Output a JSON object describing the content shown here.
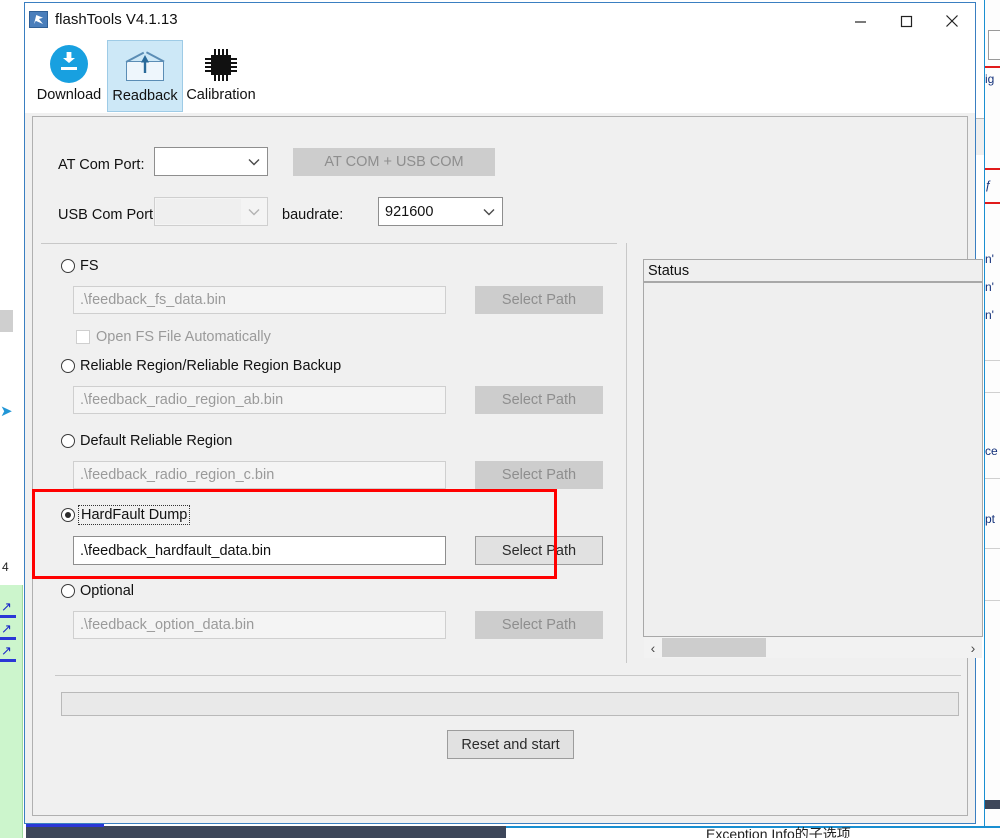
{
  "window": {
    "title": "flashTools V4.1.13",
    "app_icon": "app-icon",
    "minimize_label": "Minimize",
    "maximize_label": "Maximize",
    "close_label": "Close"
  },
  "toolbar": {
    "items": [
      {
        "label": "Download",
        "icon": "download-icon",
        "selected": false
      },
      {
        "label": "Readback",
        "icon": "envelope-upload-icon",
        "selected": true
      },
      {
        "label": "Calibration",
        "icon": "chip-icon",
        "selected": false
      }
    ]
  },
  "ports": {
    "at_com_label": "AT Com Port:",
    "at_com_value": "",
    "at_com_placeholder": "",
    "at_usb_button": "AT COM + USB COM",
    "usb_com_label": "USB Com Port:",
    "usb_com_value": "",
    "baudrate_label": "baudrate:",
    "baudrate_value": "921600"
  },
  "options": [
    {
      "id": "fs",
      "label": "FS",
      "selected": false,
      "path": ".\\feedback_fs_data.bin",
      "button": "Select Path",
      "enabled": false,
      "checkbox": {
        "label": "Open FS File Automatically",
        "checked": false
      }
    },
    {
      "id": "reliable-region-backup",
      "label": "Reliable Region/Reliable Region Backup",
      "selected": false,
      "path": ".\\feedback_radio_region_ab.bin",
      "button": "Select Path",
      "enabled": false
    },
    {
      "id": "default-reliable-region",
      "label": "Default Reliable Region",
      "selected": false,
      "path": ".\\feedback_radio_region_c.bin",
      "button": "Select Path",
      "enabled": false
    },
    {
      "id": "hardfault-dump",
      "label": "HardFault Dump",
      "selected": true,
      "path": ".\\feedback_hardfault_data.bin",
      "button": "Select Path",
      "enabled": true,
      "highlighted": true
    },
    {
      "id": "optional",
      "label": "Optional",
      "selected": false,
      "path": ".\\feedback_option_data.bin",
      "button": "Select Path",
      "enabled": false
    }
  ],
  "status": {
    "header": "Status",
    "content": "",
    "scroll_left": "‹",
    "scroll_right": "›"
  },
  "footer": {
    "progress_value": "",
    "action_button": "Reset and start"
  },
  "colors": {
    "accent_blue": "#18a0e0",
    "selected_tab": "#cde8f7",
    "highlight_red": "#ff0000",
    "window_bg": "#f0f0f0",
    "title_bg": "#ffffff"
  },
  "background": {
    "chinese_text": "Exception Info的子选项",
    "green_panel": "green-side-panel",
    "taskbar": "taskbar-strip"
  }
}
